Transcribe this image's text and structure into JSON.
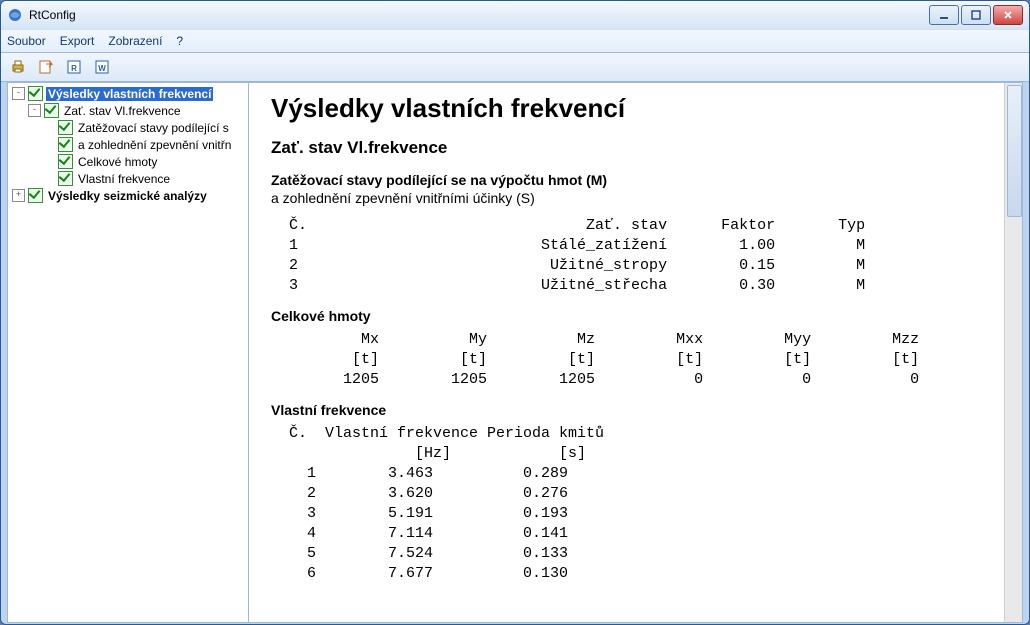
{
  "window": {
    "title": "RtConfig"
  },
  "menu": {
    "items": [
      "Soubor",
      "Export",
      "Zobrazení",
      "?"
    ]
  },
  "tree": {
    "items": [
      {
        "indent": 0,
        "toggle": "-",
        "label": "Výsledky vlastních frekvencí",
        "selected": true,
        "bold": true
      },
      {
        "indent": 1,
        "toggle": "-",
        "label": "Zať. stav Vl.frekvence"
      },
      {
        "indent": 2,
        "toggle": "",
        "label": "Zatěžovací stavy podílející s"
      },
      {
        "indent": 2,
        "toggle": "",
        "label": "a zohlednění zpevnění vnitřn"
      },
      {
        "indent": 2,
        "toggle": "",
        "label": "Celkové hmoty"
      },
      {
        "indent": 2,
        "toggle": "",
        "label": "Vlastní frekvence"
      },
      {
        "indent": 0,
        "toggle": "+",
        "label": "Výsledky seizmické analýzy",
        "bold": true
      }
    ]
  },
  "doc": {
    "h1": "Výsledky vlastních frekvencí",
    "h2": "Zať. stav Vl.frekvence",
    "loads_h3": "Zatěžovací stavy podílející se na výpočtu hmot (M)",
    "loads_sub": "a zohlednění zpevnění vnitřními účinky (S)",
    "loads_header": [
      "Č.",
      "Zať. stav",
      "Faktor",
      "Typ"
    ],
    "loads_rows": [
      {
        "n": "1",
        "name": "Stálé_zatížení",
        "factor": "1.00",
        "typ": "M"
      },
      {
        "n": "2",
        "name": "Užitné_stropy",
        "factor": "0.15",
        "typ": "M"
      },
      {
        "n": "3",
        "name": "Užitné_střecha",
        "factor": "0.30",
        "typ": "M"
      }
    ],
    "mass_h3": "Celkové hmoty",
    "mass_header": [
      "Mx",
      "My",
      "Mz",
      "Mxx",
      "Myy",
      "Mzz"
    ],
    "mass_units": [
      "[t]",
      "[t]",
      "[t]",
      "[t]",
      "[t]",
      "[t]"
    ],
    "mass_row": [
      "1205",
      "1205",
      "1205",
      "0",
      "0",
      "0"
    ],
    "freq_h3": "Vlastní frekvence",
    "freq_header1": [
      "Č.",
      "Vlastní frekvence",
      "Perioda kmitů"
    ],
    "freq_header2": [
      "",
      "[Hz]",
      "[s]"
    ],
    "freq_rows": [
      {
        "n": "1",
        "hz": "3.463",
        "s": "0.289"
      },
      {
        "n": "2",
        "hz": "3.620",
        "s": "0.276"
      },
      {
        "n": "3",
        "hz": "5.191",
        "s": "0.193"
      },
      {
        "n": "4",
        "hz": "7.114",
        "s": "0.141"
      },
      {
        "n": "5",
        "hz": "7.524",
        "s": "0.133"
      },
      {
        "n": "6",
        "hz": "7.677",
        "s": "0.130"
      }
    ]
  }
}
